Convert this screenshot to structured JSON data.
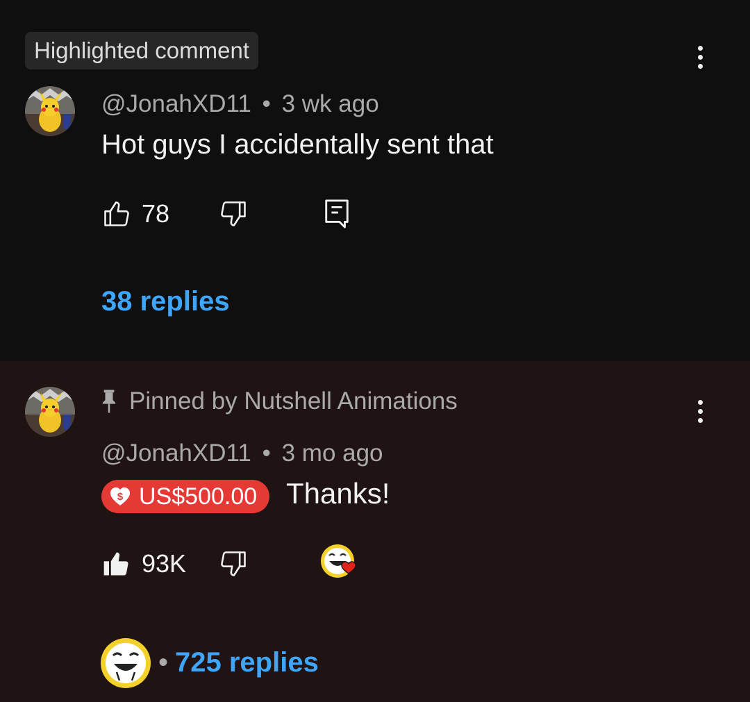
{
  "highlighted": {
    "chip_label": "Highlighted comment",
    "author": "@JonahXD11",
    "separator": "•",
    "time": "3 wk ago",
    "text": "Hot guys I accidentally sent that",
    "likes": "78",
    "replies": "38 replies"
  },
  "pinned": {
    "pinned_label": "Pinned by Nutshell Animations",
    "author": "@JonahXD11",
    "separator": "•",
    "time": "3 mo ago",
    "donation_amount": "US$500.00",
    "text": "Thanks!",
    "likes": "93K",
    "replies_sep": "•",
    "replies": "725 replies"
  },
  "colors": {
    "link": "#3ea6ff",
    "donation": "#e53935",
    "pinned_bg": "#1f1413",
    "heart": "#e0241b"
  },
  "icons": [
    "kebab-menu-icon",
    "thumbs-up-icon",
    "thumbs-down-icon",
    "reply-icon",
    "pin-icon",
    "donation-heart-icon",
    "creator-heart-icon"
  ]
}
